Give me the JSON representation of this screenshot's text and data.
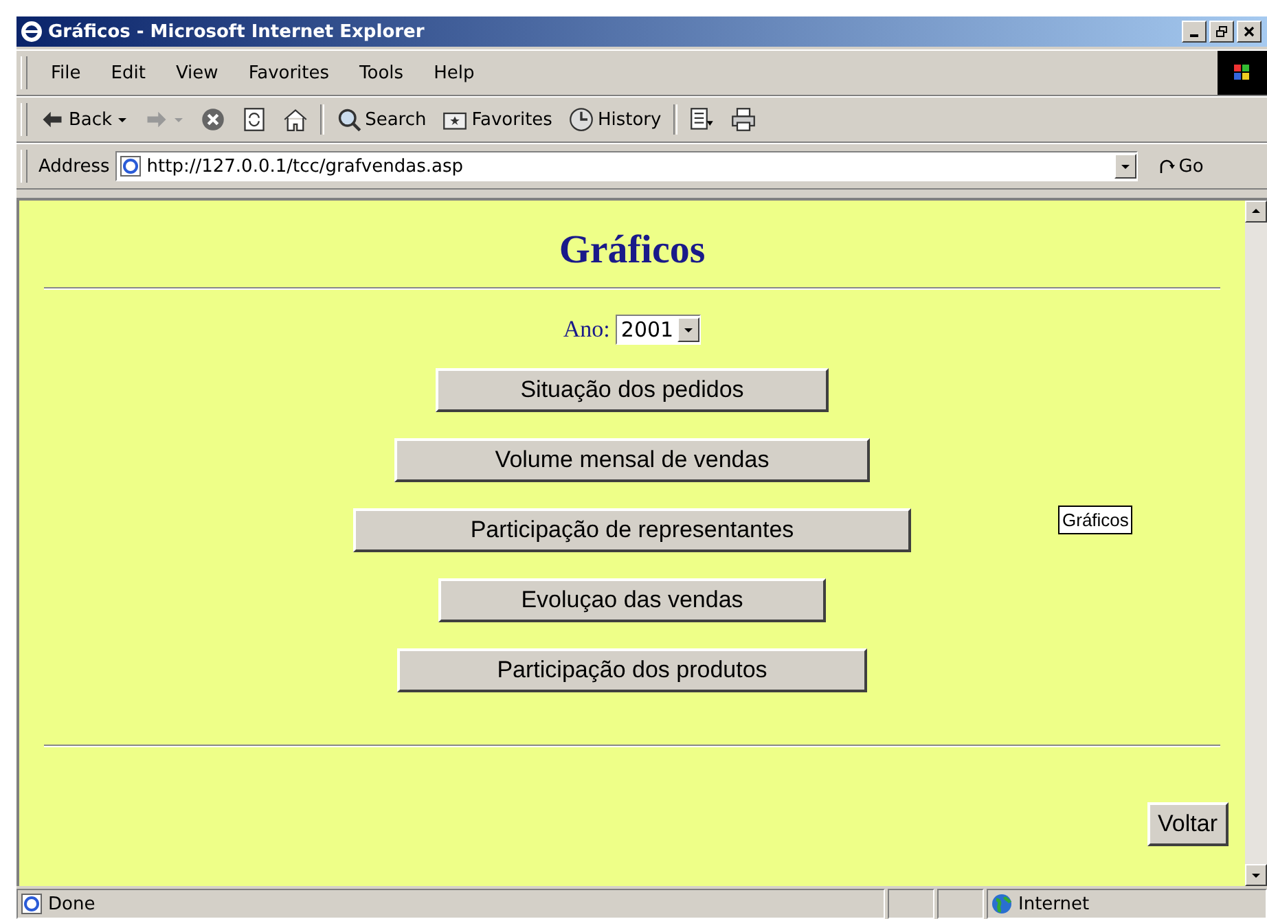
{
  "window": {
    "title": "Gráficos - Microsoft Internet Explorer"
  },
  "menu": [
    "File",
    "Edit",
    "View",
    "Favorites",
    "Tools",
    "Help"
  ],
  "toolbar": [
    {
      "kind": "back",
      "label": "Back"
    },
    {
      "kind": "forward"
    },
    {
      "kind": "stop"
    },
    {
      "kind": "refresh"
    },
    {
      "kind": "home"
    },
    {
      "kind": "search",
      "label": "Search"
    },
    {
      "kind": "favorites",
      "label": "Favorites"
    },
    {
      "kind": "history",
      "label": "History"
    },
    {
      "kind": "mail"
    },
    {
      "kind": "print"
    }
  ],
  "address": {
    "label": "Address",
    "url": "http://127.0.0.1/tcc/grafvendas.asp",
    "go": "Go"
  },
  "page": {
    "title": "Gráficos",
    "year_label": "Ano:",
    "year": "2001",
    "buttons": [
      "Situação dos pedidos",
      "Volume mensal de vendas",
      "Participação de representantes",
      "Evoluçao das vendas",
      "Participação dos produtos"
    ],
    "tooltip": "Gráficos",
    "back_button": "Voltar"
  },
  "status_bar": {
    "text": "Done",
    "zone": "Internet"
  }
}
